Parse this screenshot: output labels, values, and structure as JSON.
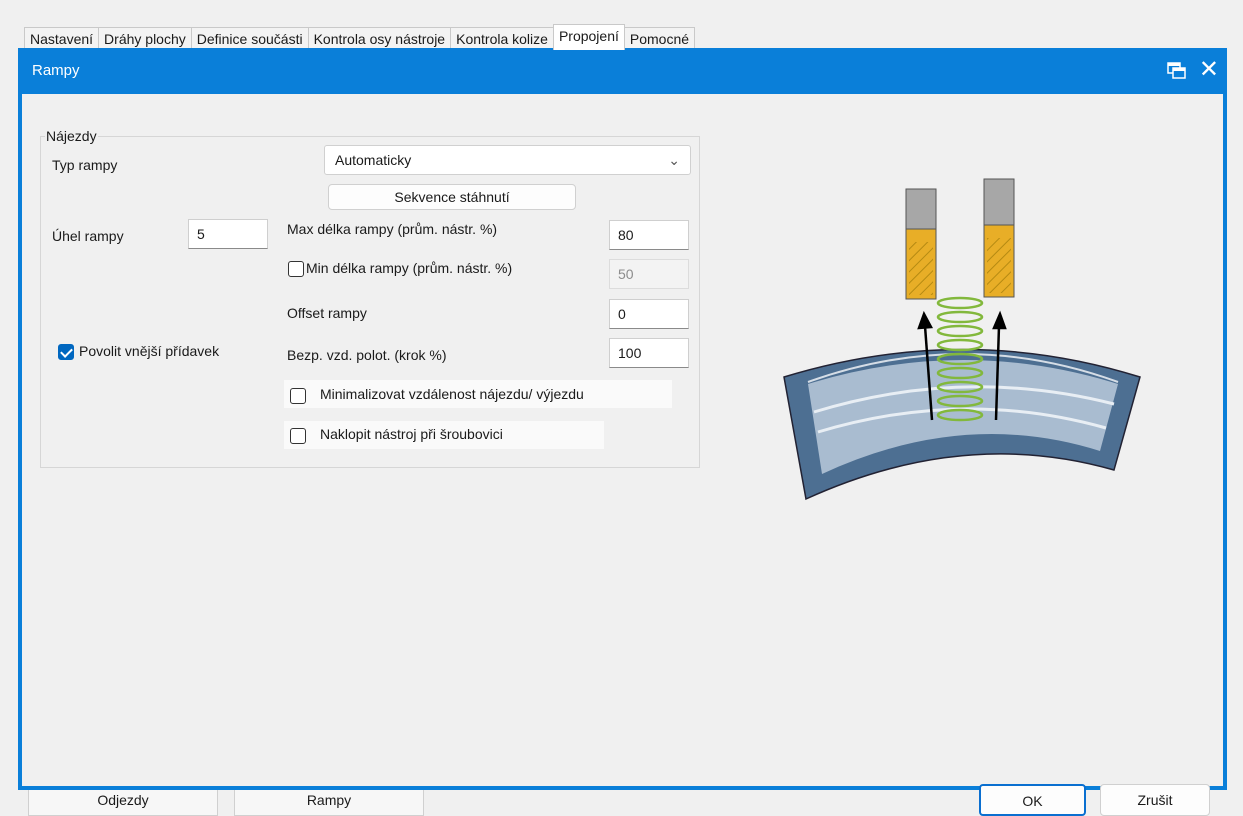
{
  "background_tabs": [
    "Nastavení",
    "Dráhy plochy",
    "Definice součásti",
    "Kontrola osy nástroje",
    "Kontrola kolize",
    "Propojení",
    "Pomocné"
  ],
  "active_background_tab": "Propojení",
  "bottom_tabs": [
    "Odjezdy",
    "Rampy"
  ],
  "dialog": {
    "title": "Rampy",
    "accent": "#0a7fd9",
    "group_title": "Nájezdy",
    "ramp_type_label": "Typ rampy",
    "ramp_type_value": "Automaticky",
    "retract_sequence_button": "Sekvence stáhnutí",
    "ramp_angle_label": "Úhel rampy",
    "ramp_angle_value": "5",
    "max_length_label": "Max délka rampy (prům. nástr. %)",
    "max_length_value": "80",
    "min_length_label": "Min délka rampy (prům. nástr. %)",
    "min_length_checked": false,
    "min_length_value": "50",
    "offset_label": "Offset rampy",
    "offset_value": "0",
    "allow_allowance_label": "Povolit vnější přídavek",
    "allow_allowance_checked": true,
    "safe_distance_label": "Bezp. vzd. polot. (krok %)",
    "safe_distance_value": "100",
    "minimize_label": "Minimalizovat  vzdálenost  nájezdu/  výjezdu",
    "minimize_checked": false,
    "tilt_label": "Naklopit  nástroj  při  šroubovici",
    "tilt_checked": false,
    "ok_button": "OK",
    "cancel_button": "Zrušit",
    "close_icon": "close-icon",
    "restore_icon": "restore-window-icon"
  }
}
